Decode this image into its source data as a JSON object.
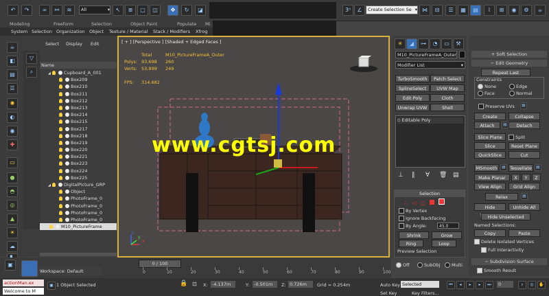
{
  "top_toolbar": {
    "filter_dropdown": "All",
    "selection_set": "Create Selection Se"
  },
  "ribbon_tabs": [
    "Modeling",
    "Freeform",
    "Selection",
    "Object Paint",
    "Populate",
    "Mi"
  ],
  "menu": [
    "System",
    "Selection",
    "Organization",
    "Object",
    "Texture / Material",
    "Stack / Modifiers",
    "Xfrog"
  ],
  "scene_explorer": {
    "tabs": [
      "Select",
      "Display",
      "Edit"
    ],
    "column_header": "Name",
    "rows": [
      {
        "label": "Cupboard_A_001",
        "indent": 1,
        "kind": "group"
      },
      {
        "label": "Box209",
        "indent": 2,
        "kind": "obj"
      },
      {
        "label": "Box210",
        "indent": 2,
        "kind": "obj"
      },
      {
        "label": "Box211",
        "indent": 2,
        "kind": "obj"
      },
      {
        "label": "Box212",
        "indent": 2,
        "kind": "obj"
      },
      {
        "label": "Box213",
        "indent": 2,
        "kind": "obj"
      },
      {
        "label": "Box214",
        "indent": 2,
        "kind": "obj"
      },
      {
        "label": "Box215",
        "indent": 2,
        "kind": "obj"
      },
      {
        "label": "Box217",
        "indent": 2,
        "kind": "obj"
      },
      {
        "label": "Box218",
        "indent": 2,
        "kind": "obj"
      },
      {
        "label": "Box219",
        "indent": 2,
        "kind": "obj"
      },
      {
        "label": "Box220",
        "indent": 2,
        "kind": "obj"
      },
      {
        "label": "Box221",
        "indent": 2,
        "kind": "obj"
      },
      {
        "label": "Box223",
        "indent": 2,
        "kind": "obj"
      },
      {
        "label": "Box224",
        "indent": 2,
        "kind": "obj"
      },
      {
        "label": "Box225",
        "indent": 2,
        "kind": "obj"
      },
      {
        "label": "DigitalPicture_GRP",
        "indent": 1,
        "kind": "group"
      },
      {
        "label": "Object",
        "indent": 2,
        "kind": "obj"
      },
      {
        "label": "PhotoFrame_0",
        "indent": 2,
        "kind": "obj"
      },
      {
        "label": "PhotoFrame_0",
        "indent": 2,
        "kind": "obj"
      },
      {
        "label": "PhotoFrame_0",
        "indent": 2,
        "kind": "obj"
      },
      {
        "label": "PhotoFrame_0",
        "indent": 2,
        "kind": "obj"
      },
      {
        "label": "M10_PictureFrame",
        "indent": 1,
        "kind": "selected"
      }
    ],
    "workspace": "Workspace: Default"
  },
  "viewport": {
    "label": "[ + ] [Perspective ] [Shaded + Edged Faces ]",
    "stats": {
      "total_label": "Total",
      "object_name": "M10_PictureFrameA_Outer",
      "polys_label": "Polys:",
      "polys_total": "93,698",
      "polys_sel": "260",
      "verts_label": "Verts:",
      "verts_total": "53,899",
      "verts_sel": "249",
      "fps_label": "FPS:",
      "fps": "314.682"
    },
    "watermark": "www.cgtsj.com"
  },
  "command_panel": {
    "object_name": "M10_PictureFrameA_Outer",
    "modifier_list": "Modifier List",
    "modifier_buttons": [
      "TurboSmooth",
      "Patch Select",
      "SplineSelect",
      "UVW Map",
      "Edit Poly",
      "Cloth",
      "Unwrap UVW",
      "Shell"
    ],
    "stack_item": "Editable Poly",
    "selection": {
      "title": "Selection",
      "by_vertex": "By Vertex",
      "ignore_backfacing": "Ignore Backfacing",
      "by_angle": "By Angle:",
      "angle_value": "45.0",
      "shrink": "Shrink",
      "grow": "Grow",
      "ring": "Ring",
      "loop": "Loop",
      "preview_title": "Preview Selection",
      "off": "Off",
      "subobj": "SubObj",
      "multi": "Multi"
    }
  },
  "right_panel": {
    "soft_selection": "Soft Selection",
    "edit_geometry": "Edit Geometry",
    "repeat_last": "Repeat Last",
    "constraints": "Constraints",
    "c_none": "None",
    "c_edge": "Edge",
    "c_face": "Face",
    "c_normal": "Normal",
    "preserve_uvs": "Preserve UVs",
    "create": "Create",
    "collapse": "Collapse",
    "attach": "Attach",
    "detach": "Detach",
    "slice_plane": "Slice Plane",
    "split": "Split",
    "slice": "Slice",
    "reset_plane": "Reset Plane",
    "quickslice": "QuickSlice",
    "cut": "Cut",
    "msmooth": "MSmooth",
    "tessellate": "Tessellate",
    "make_planar": "Make Planar",
    "x": "X",
    "y": "Y",
    "z": "Z",
    "view_align": "View Align",
    "grid_align": "Grid Align",
    "relax": "Relax",
    "hide_selected": "Hide Selected",
    "unhide_all": "Unhide All",
    "hide_unselected": "Hide Unselected",
    "named_selections": "Named Selections:",
    "copy": "Copy",
    "paste": "Paste",
    "delete_isolated": "Delete Isolated Vertices",
    "full_interactivity": "Full Interactivity",
    "subdivision_surface": "Subdivision Surface",
    "smooth_result": "Smooth Result"
  },
  "timeline": {
    "frame": "0 / 100",
    "ticks": [
      "0",
      "10",
      "20",
      "30",
      "40",
      "50",
      "60",
      "70",
      "80",
      "90",
      "100"
    ]
  },
  "status": {
    "script_listener": "actionMan.ex",
    "welcome": "Welcome to M",
    "objects_selected": "1 Object Selected",
    "x_label": "X:",
    "x_value": "-4.137m",
    "y_label": "Y:",
    "y_value": "-0.501m",
    "z_label": "Z:",
    "z_value": "0.726m",
    "grid": "Grid = 0.254m",
    "auto_key": "Auto Key",
    "set_key": "Set Key",
    "selected": "Selected",
    "key_filters": "Key Filters...",
    "frame_field": "0"
  }
}
